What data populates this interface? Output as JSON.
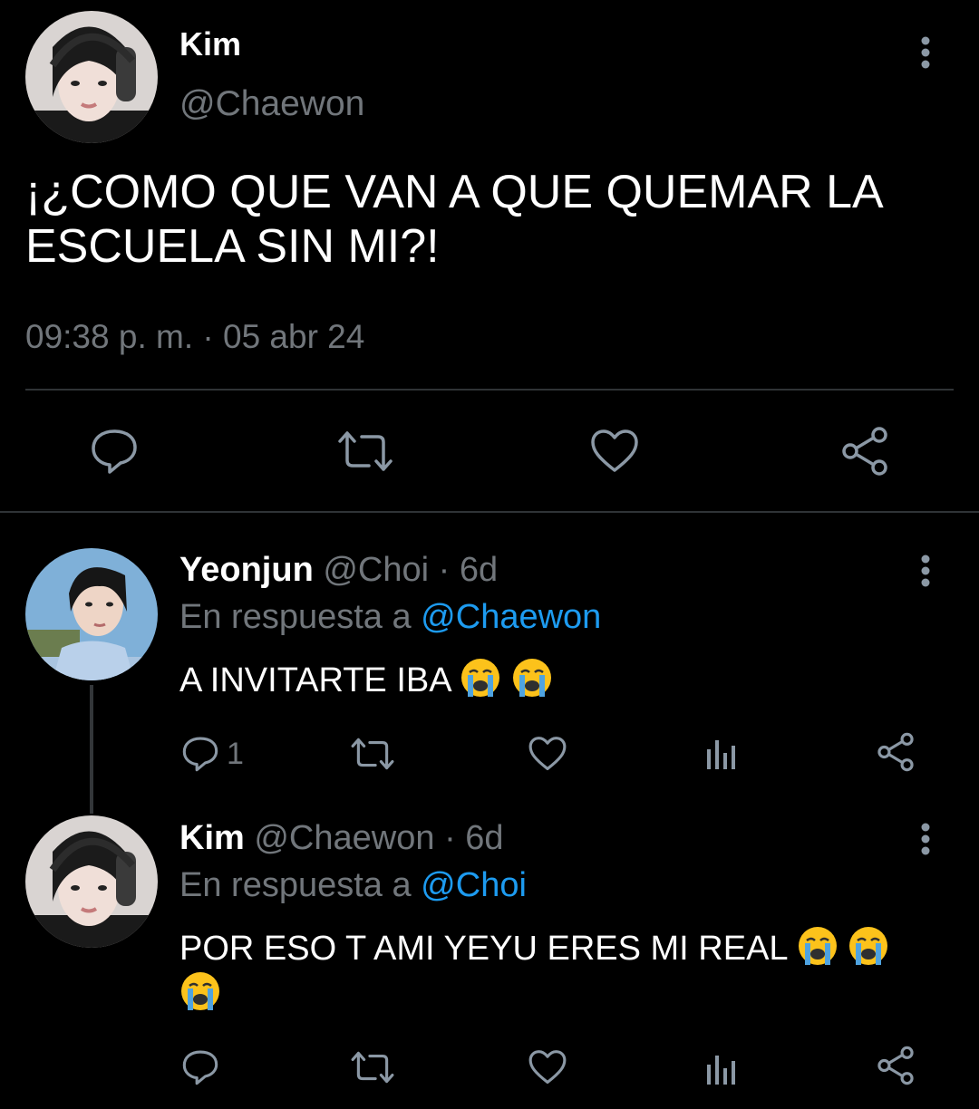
{
  "main_tweet": {
    "name": "Kim",
    "handle": "@Chaewon",
    "text": "¡¿COMO QUE VAN A QUE QUEMAR LA ESCUELA SIN MI?!",
    "timestamp": "09:38 p. m. · 05 abr 24",
    "actions": [
      "reply-icon",
      "retweet-icon",
      "like-icon",
      "share-icon"
    ]
  },
  "replies": [
    {
      "name": "Yeonjun",
      "handle": "@Choi",
      "dot": "·",
      "time": "6d",
      "reply_prefix": "En respuesta a",
      "reply_to": "@Chaewon",
      "text": "A INVITARTE IBA",
      "emoji": [
        "😭",
        "😭"
      ],
      "reply_count": "1"
    },
    {
      "name": "Kim",
      "handle": "@Chaewon",
      "dot": "·",
      "time": "6d",
      "reply_prefix": "En respuesta a",
      "reply_to": "@Choi",
      "text": "POR ESO T AMI YEYU ERES MI REAL",
      "emoji": [
        "😭",
        "😭",
        "😭"
      ],
      "reply_count": ""
    }
  ],
  "colors": {
    "background": "#000000",
    "text_primary": "#ffffff",
    "text_secondary": "#71767b",
    "accent": "#1d9bf0",
    "divider": "#2f3336",
    "icon": "#8b98a5"
  }
}
